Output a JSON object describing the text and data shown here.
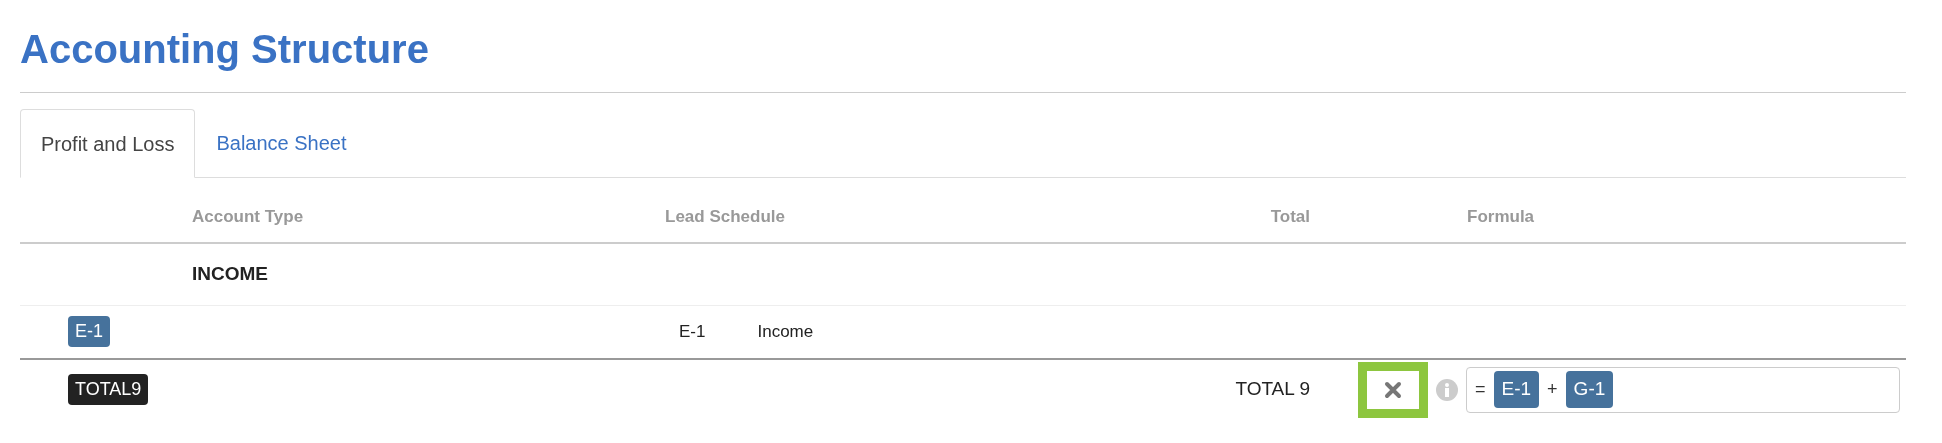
{
  "title": "Accounting Structure",
  "tabs": [
    {
      "label": "Profit and Loss",
      "selected": true
    },
    {
      "label": "Balance Sheet",
      "selected": false
    }
  ],
  "table": {
    "columns": [
      "Account Type",
      "Lead Schedule",
      "Total",
      "Formula"
    ],
    "rows": [
      {
        "kind": "section",
        "account_type": "INCOME"
      },
      {
        "kind": "account",
        "badge": "E-1",
        "color": "#46729c",
        "lead_code": "E-1",
        "lead_name": "Income"
      },
      {
        "kind": "total",
        "badge": "TOTAL9",
        "color": "#222222",
        "total": "TOTAL 9",
        "highlighted": true,
        "formula": [
          {
            "kind": "operator",
            "text": "="
          },
          {
            "kind": "token",
            "text": "E-1"
          },
          {
            "kind": "operator",
            "text": "+"
          },
          {
            "kind": "token",
            "text": "G-1"
          }
        ]
      }
    ]
  }
}
